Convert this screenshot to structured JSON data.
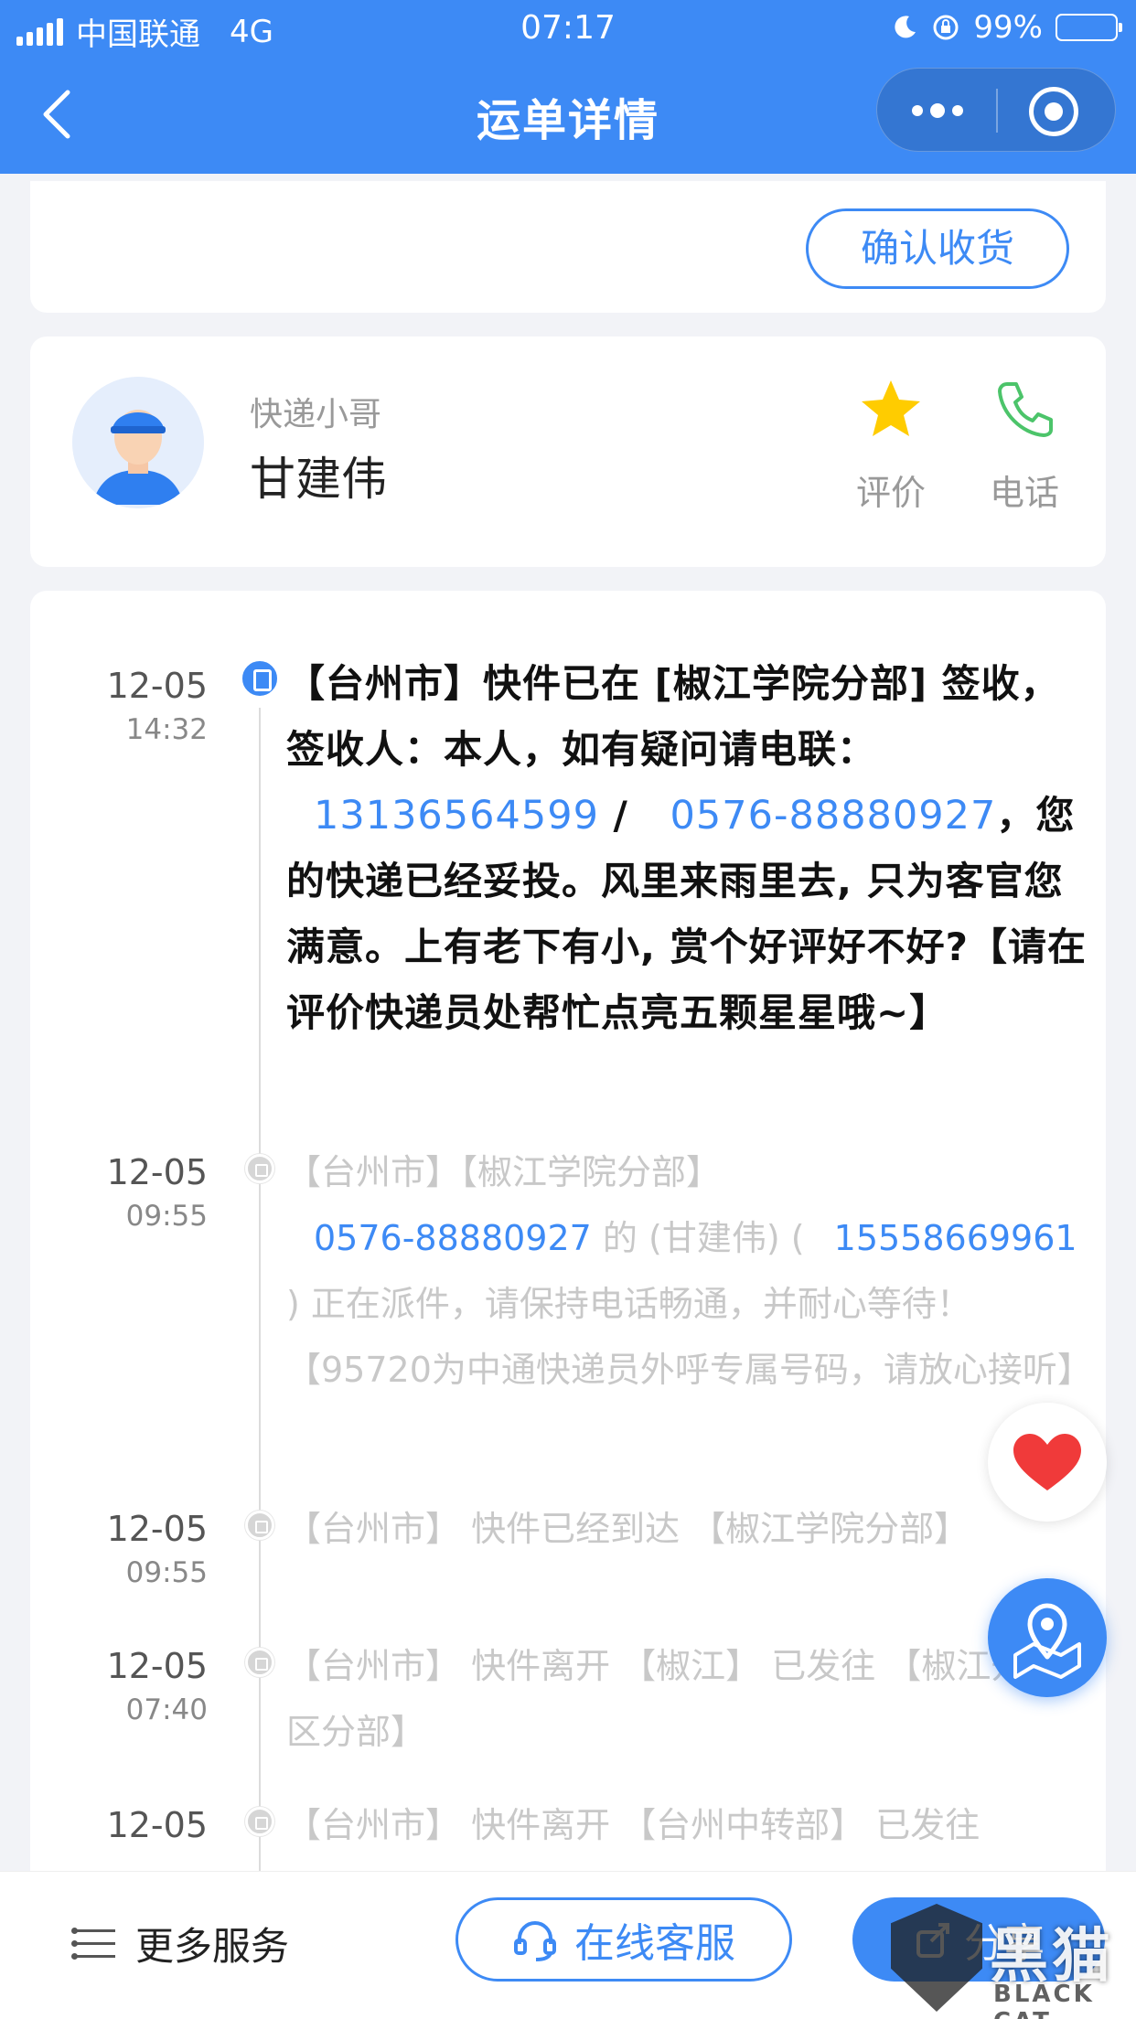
{
  "status_bar": {
    "carrier": "中国联通",
    "network": "4G",
    "time": "07:17",
    "battery": "99%"
  },
  "nav": {
    "title": "运单详情"
  },
  "order": {
    "confirm_label": "确认收货"
  },
  "courier": {
    "role": "快递小哥",
    "name": "甘建伟",
    "rate_label": "评价",
    "phone_label": "电话"
  },
  "timeline": [
    {
      "date": "12-05",
      "time": "14:32",
      "text_a": "【台州市】快件已在 [椒江学院分部] 签收，签收人：本人，如有疑问请电联：",
      "phone1": "13136564599",
      "sep": " / ",
      "phone2": "0576-88880927",
      "text_b": "，您的快递已经妥投。风里来雨里去, 只为客官您满意。上有老下有小, 赏个好评好不好?【请在评价快递员处帮忙点亮五颗星星哦~】"
    },
    {
      "date": "12-05",
      "time": "09:55",
      "text_a": "【台州市】【椒江学院分部】",
      "phone1": "0576-88880927",
      "text_mid": " 的 (甘建伟) ( ",
      "phone2": "15558669961",
      "text_b": " ) 正在派件，请保持电话畅通，并耐心等待！【95720为中通快递员外呼专属号码，请放心接听】"
    },
    {
      "date": "12-05",
      "time": "09:55",
      "text": "【台州市】 快件已经到达 【椒江学院分部】"
    },
    {
      "date": "12-05",
      "time": "07:40",
      "text": "【台州市】 快件离开 【椒江】 已发往 【椒江开发区分部】"
    },
    {
      "date": "12-05",
      "time": "",
      "text": "【台州市】 快件离开 【台州中转部】 已发往"
    }
  ],
  "bottom": {
    "more_label": "更多服务",
    "cs_label": "在线客服",
    "share_label": "分享"
  },
  "watermark": {
    "cn": "黑猫",
    "en": "BLACK CAT"
  },
  "colors": {
    "primary": "#3d8af5",
    "background": "#f2f3f7",
    "star": "#ffcc00",
    "phone_icon": "#4cc46a",
    "heart": "#f03a3a"
  }
}
